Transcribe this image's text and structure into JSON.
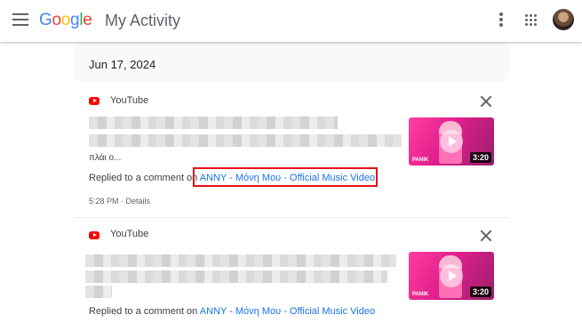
{
  "header": {
    "logo": [
      "G",
      "o",
      "o",
      "g",
      "l",
      "e"
    ],
    "product": "My Activity"
  },
  "date_group": {
    "date": "Jun 17, 2024"
  },
  "items": [
    {
      "product": "YouTube",
      "snippet_tail": "πλάι ο...",
      "action_prefix": "Replied to a comment on",
      "link_text": "ANNY - Μόνη Μου - Official Music Video",
      "time": "5:28 PM",
      "details_label": "Details",
      "thumbnail": {
        "brand": "PANIK",
        "duration": "3:20"
      }
    },
    {
      "product": "YouTube",
      "action_prefix": "Replied to a comment on",
      "link_text": "ANNY - Μόνη Μου - Official Music Video",
      "thumbnail": {
        "brand": "PANIK",
        "duration": "3:20"
      }
    }
  ],
  "icons": {
    "menu": "hamburger-icon",
    "more": "more-vert-icon",
    "apps": "apps-grid-icon",
    "product": "youtube-icon",
    "delete": "close-icon"
  },
  "colors": {
    "link": "#1a73e8",
    "highlight": "#e8101b",
    "youtube": "#ff0000"
  }
}
